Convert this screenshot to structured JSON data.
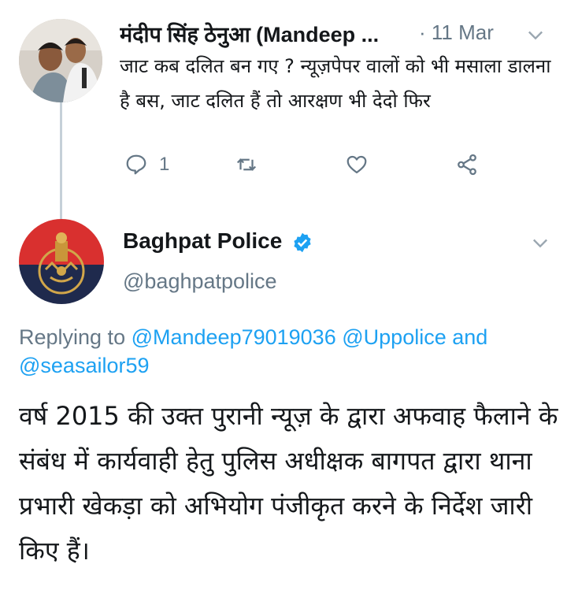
{
  "reply_tweet": {
    "author_name": "मंदीप सिंह ठेनुआ (Mandeep ...",
    "timestamp": "· 11 Mar",
    "text": "जाट कब दलित बन गए ? न्यूज़पेपर वालों को भी मसाला डालना है बस, जाट दलित हैं तो आरक्षण भी देदो फिर",
    "reply_count": "1",
    "icons": [
      "reply-icon",
      "retweet-icon",
      "like-icon",
      "share-icon",
      "chevron-down-icon"
    ]
  },
  "main_tweet": {
    "author_name": "Baghpat Police",
    "handle": "@baghpatpolice",
    "verified": true,
    "replying_prefix": "Replying to ",
    "replying_mentions": [
      "@Mandeep79019036",
      "@Uppolice"
    ],
    "replying_and": " and ",
    "replying_last": "@seasailor59",
    "text": "वर्ष 2015 की उक्त पुरानी न्यूज़ के द्वारा अफवाह फैलाने के संबंध में कार्यवाही हेतु पुलिस अधीक्षक बागपत द्वारा थाना प्रभारी खेकड़ा को अभियोग पंजीकृत करने के निर्देश जारी किए हैं।"
  },
  "colors": {
    "link": "#1da1f2",
    "muted": "#657786",
    "text": "#14171a",
    "thread_line": "#c5d0d8",
    "badge_red": "#d9302f",
    "badge_navy": "#1f2a4d"
  }
}
